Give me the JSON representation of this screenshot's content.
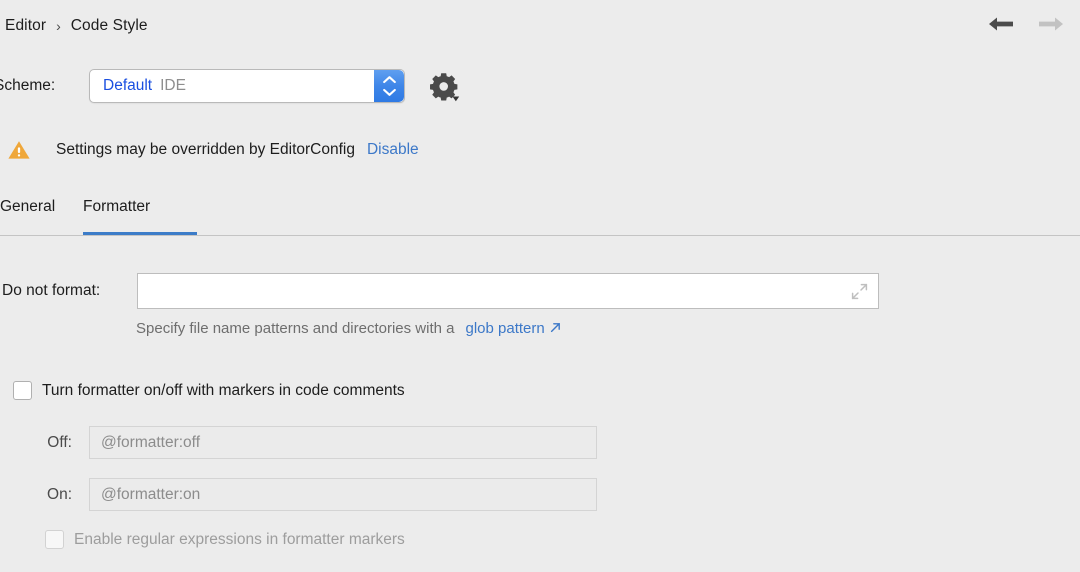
{
  "breadcrumb": {
    "items": [
      "Editor",
      "Code Style"
    ],
    "separator": "›"
  },
  "nav": {
    "back_icon": "arrow-left-icon",
    "forward_icon": "arrow-right-icon"
  },
  "scheme": {
    "label": "Scheme:",
    "value": "Default",
    "suffix": "IDE",
    "gear_icon": "gear-icon",
    "stepper_icon": "updown-stepper-icon"
  },
  "warning": {
    "icon": "warning-triangle-icon",
    "text": "Settings may be overridden by EditorConfig",
    "link": "Disable"
  },
  "tabs": [
    {
      "label": "General",
      "selected": false
    },
    {
      "label": "Formatter",
      "selected": true
    }
  ],
  "form": {
    "do_not_format": {
      "label": "Do not format:",
      "value": "",
      "placeholder": "",
      "expand_icon": "expand-diagonal-icon"
    },
    "hint": {
      "text": "Specify file name patterns and directories with a",
      "link": "glob pattern",
      "link_icon": "external-link-arrow-icon"
    },
    "markers_checkbox": {
      "label": "Turn formatter on/off with markers in code comments",
      "checked": false,
      "disabled": false
    },
    "off_field": {
      "label": "Off:",
      "value": "",
      "placeholder": "@formatter:off",
      "disabled": true
    },
    "on_field": {
      "label": "On:",
      "value": "",
      "placeholder": "@formatter:on",
      "disabled": true
    },
    "regex_checkbox": {
      "label": "Enable regular expressions in formatter markers",
      "checked": false,
      "disabled": true
    }
  },
  "colors": {
    "background": "#ececec",
    "accent_blue": "#3c7cc8",
    "link_blue": "#3c78c8",
    "value_blue": "#1a4fe0",
    "warning_amber": "#efa73a",
    "field_white": "#ffffff",
    "disabled_field": "#ebebeb",
    "disabled_text": "#9d9d9d"
  }
}
